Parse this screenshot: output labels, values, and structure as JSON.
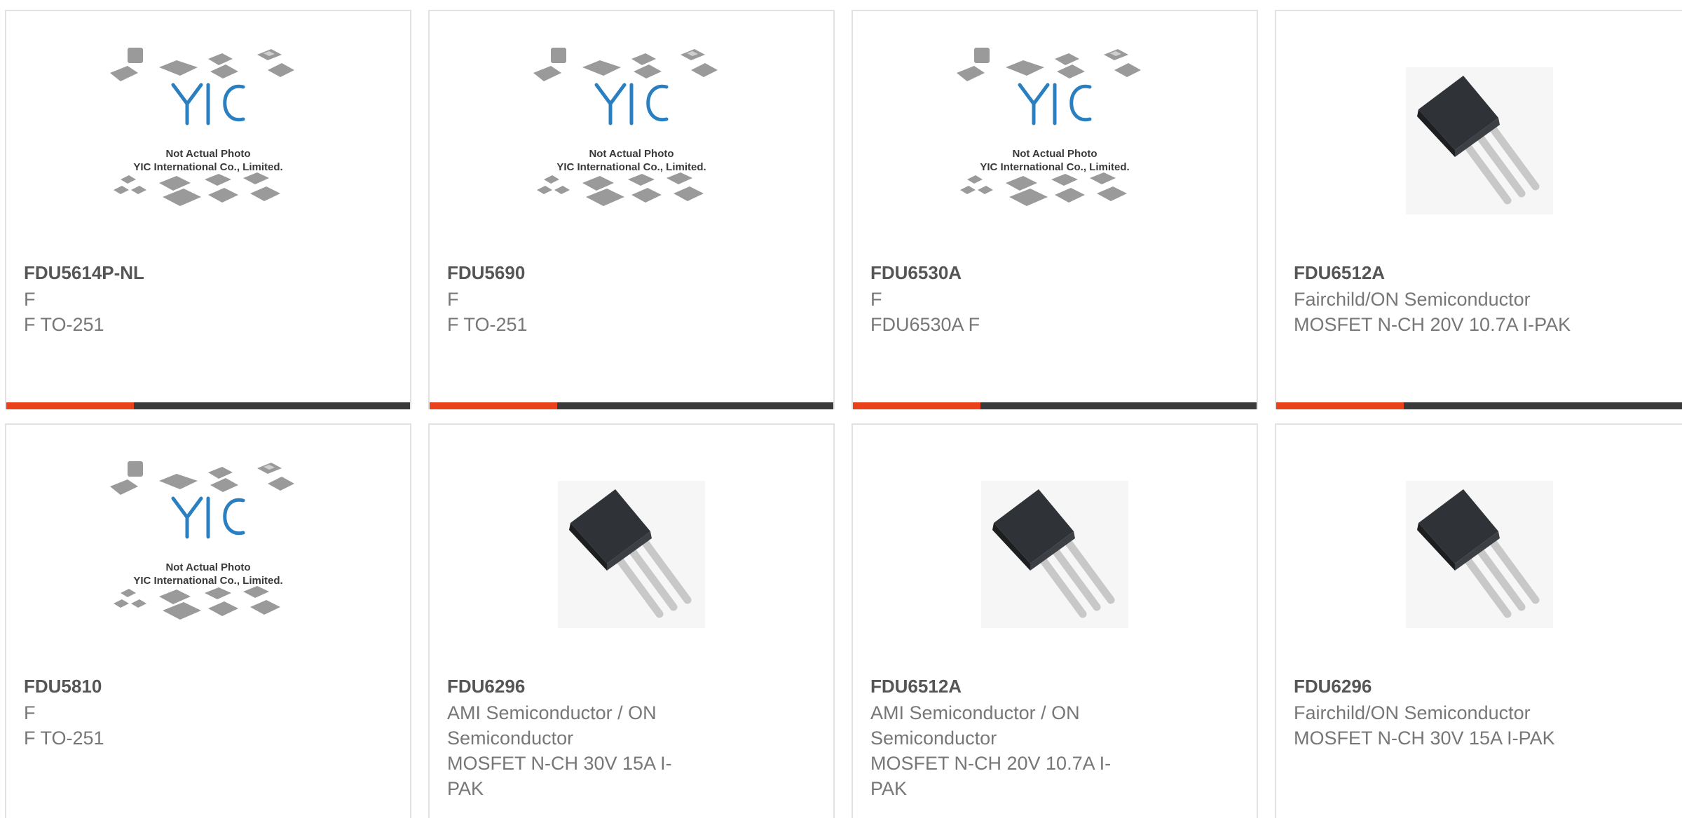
{
  "colors": {
    "accent": "#e8411c",
    "bar": "#3a3a3a",
    "logo": "#2a7fc1",
    "title": "#555555",
    "text": "#777777"
  },
  "placeholder": {
    "caption_line1": "Not Actual Photo",
    "caption_line2": "YIC International Co., Limited.",
    "logo_text": "YIC"
  },
  "products": [
    {
      "part": "FDU5614P-NL",
      "maker": "F",
      "desc": "F TO-251",
      "image": "placeholder-photo"
    },
    {
      "part": "FDU5690",
      "maker": "F",
      "desc": "F TO-251",
      "image": "placeholder-photo"
    },
    {
      "part": "FDU6530A",
      "maker": "F",
      "desc": "FDU6530A F",
      "image": "placeholder-photo"
    },
    {
      "part": "FDU6512A",
      "maker": "Fairchild/ON Semiconductor",
      "desc": "MOSFET N-CH 20V 10.7A I-PAK",
      "image": "ipak-transistor"
    },
    {
      "part": "FDU5810",
      "maker": "F",
      "desc": "F TO-251",
      "image": "placeholder-photo"
    },
    {
      "part": "FDU6296",
      "maker": "AMI Semiconductor / ON Semiconductor",
      "desc": "MOSFET N-CH 30V 15A I-PAK",
      "image": "ipak-transistor"
    },
    {
      "part": "FDU6512A",
      "maker": "AMI Semiconductor / ON Semiconductor",
      "desc": "MOSFET N-CH 20V 10.7A I-PAK",
      "image": "ipak-transistor"
    },
    {
      "part": "FDU6296",
      "maker": "Fairchild/ON Semiconductor",
      "desc": "MOSFET N-CH 30V 15A I-PAK",
      "image": "ipak-transistor"
    }
  ]
}
